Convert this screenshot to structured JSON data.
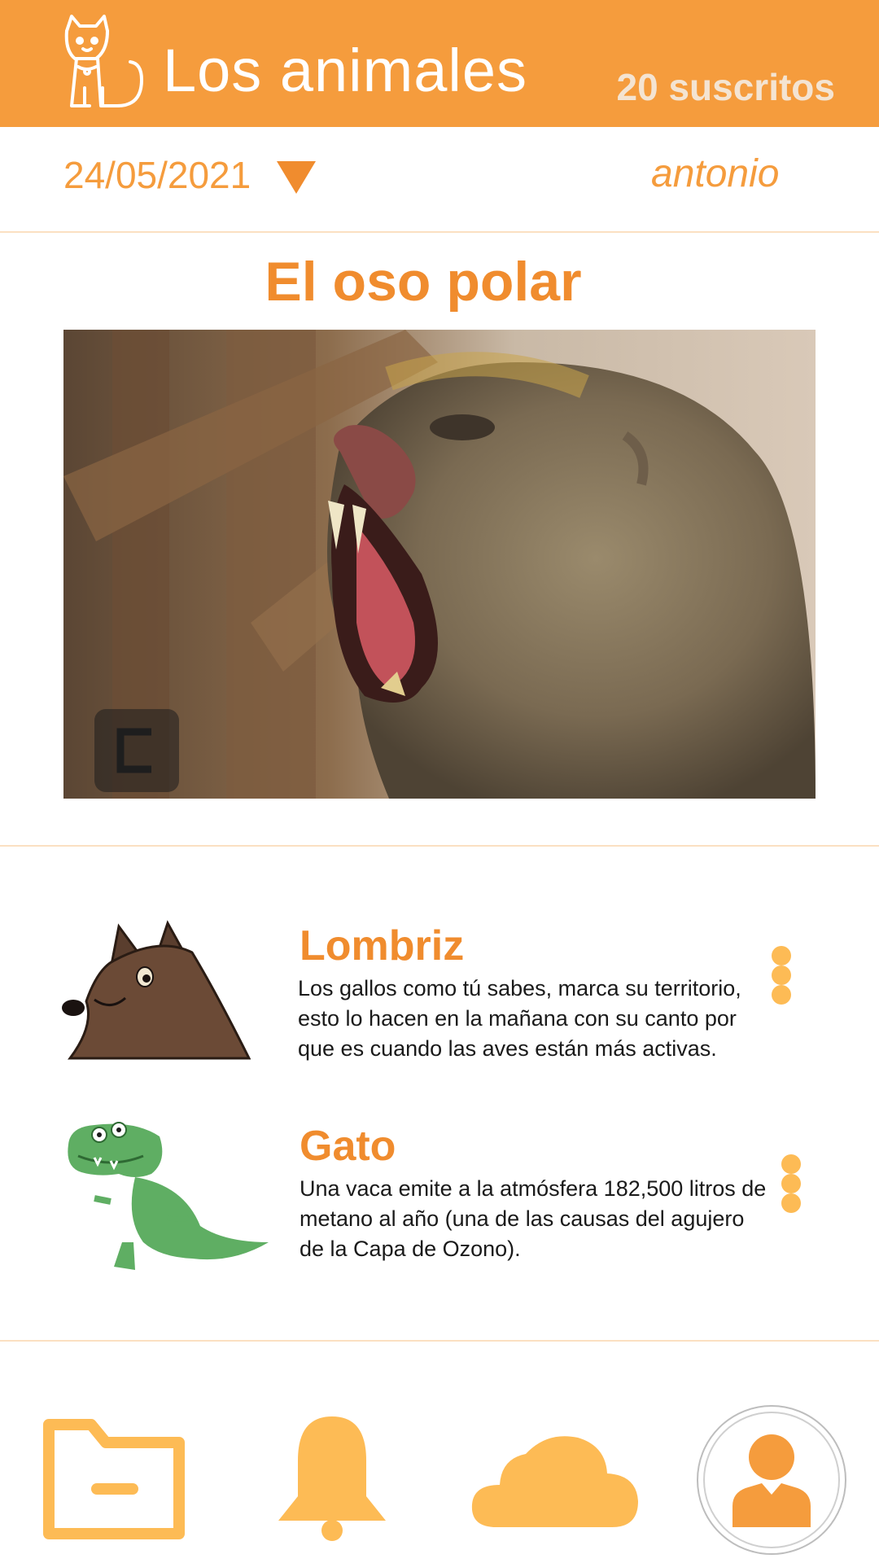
{
  "header": {
    "title": "Los animales",
    "subscribers": "20 suscritos",
    "logo_icon": "dog-logo-icon"
  },
  "filter": {
    "date": "24/05/2021",
    "user": "antonio"
  },
  "article": {
    "title": "El oso polar",
    "image_alt": "Mono aullando"
  },
  "items": [
    {
      "name": "Lombriz",
      "lines": [
        "Los gallos como tú sabes, marca su territorio,",
        "esto lo hacen en la mañana con su canto por",
        "que es cuando las aves están más activas."
      ]
    },
    {
      "name": "Gato",
      "lines": [
        "Una vaca emite a la atmósfera 182,500 litros de",
        "metano al año (una de las causas del agujero",
        "de la Capa de Ozono)."
      ]
    }
  ],
  "nav": [
    "folder-icon",
    "bell-icon",
    "cloud-icon",
    "profile-icon"
  ],
  "colors": {
    "brand": "#f59c3d",
    "accent": "#f08c2e",
    "nav": "#fdbb55",
    "subscribers": "#f4e4d2"
  }
}
